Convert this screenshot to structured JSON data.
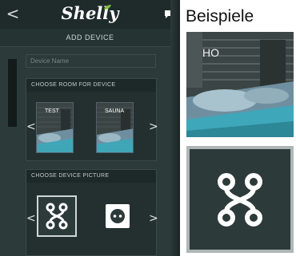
{
  "app": {
    "logo_text": "Shelly",
    "back_label": "<",
    "header_title": "ADD DEVICE"
  },
  "device_name": {
    "placeholder": "Device Name"
  },
  "room_section": {
    "title": "CHOOSE ROOM FOR DEVICE",
    "prev_label": "<",
    "next_label": ">",
    "rooms": [
      {
        "label": "TEST"
      },
      {
        "label": "SAUNA"
      }
    ]
  },
  "picture_section": {
    "title": "CHOOSE DEVICE PICTURE",
    "prev_label": "<",
    "next_label": ">",
    "options": [
      {
        "icon": "node-graph-icon",
        "selected": true
      },
      {
        "icon": "power-socket-icon",
        "selected": false
      }
    ]
  },
  "examples": {
    "title": "Beispiele",
    "photo_label": "HO",
    "icon_example": "node-graph-icon"
  },
  "colors": {
    "panel_bg": "#2d3a3a",
    "topbar_bg": "#1f2b2b",
    "accent_green": "#7fbf3f",
    "notification_red": "#e0463c"
  }
}
